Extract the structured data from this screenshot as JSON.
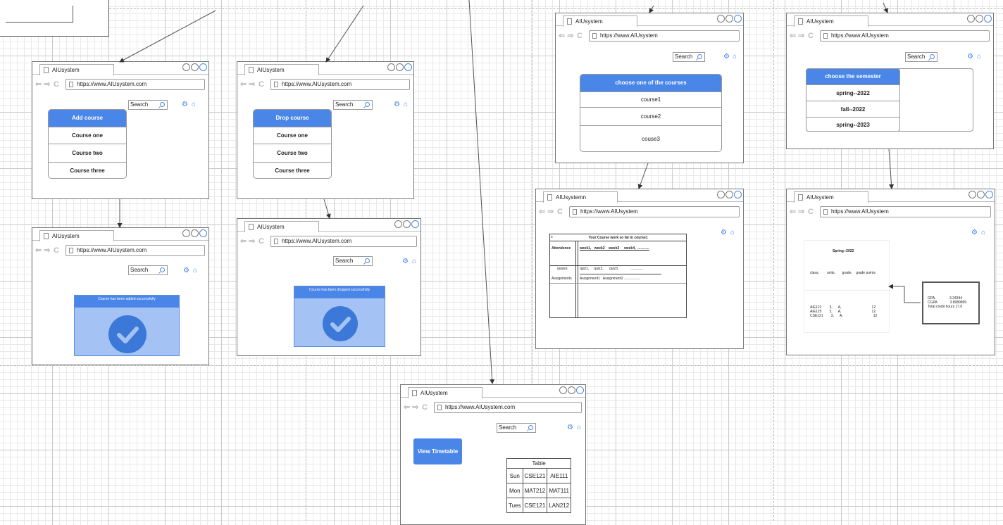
{
  "colors": {
    "accent": "#4a86e8",
    "confirm_panel": "#a4c2f4",
    "check": "#3c78d8"
  },
  "icons": {
    "back": "arrow-left-icon",
    "forward": "arrow-right-icon",
    "reload": "reload-icon",
    "settings": "gear-icon",
    "home": "home-icon",
    "search": "search-icon",
    "check": "checkmark-icon"
  },
  "glyphs": {
    "back": "⇐",
    "forward": "⇒",
    "reload": "C",
    "gear": "⚙",
    "home": "⌂"
  },
  "common": {
    "search_label": "Search"
  },
  "windows": {
    "add": {
      "tab": "AIUsystem",
      "url": "https://www.AIUsystem.com",
      "menu": {
        "header": "Add course",
        "items": [
          "Course one",
          "Course two",
          "Course three"
        ]
      }
    },
    "drop": {
      "tab": "AIUsystem",
      "url": "https://www.AIUsystem.com",
      "menu": {
        "header": "Drop course",
        "items": [
          "Course one",
          "Course two",
          "Course three"
        ]
      }
    },
    "added": {
      "tab": "AIUsystem",
      "url": "https://www.AIUsystem.com",
      "message": "Course has been added successfully"
    },
    "dropped": {
      "tab": "AIUsystem",
      "url": "https://www.AIUsystem.com",
      "message": "Course has been dropped successfully"
    },
    "choose_course": {
      "tab": "AIUsystem",
      "url": "https://www.AIUsystem",
      "menu": {
        "header": "choose one of the courses",
        "items": [
          "course1",
          "course2",
          "couse3"
        ]
      }
    },
    "choose_semester": {
      "tab": "AIUsystem",
      "url": "https://www.AIUsystem",
      "menu": {
        "header": "choose the semester",
        "items": [
          "spring--2022",
          "fall--2022",
          "spring--2023"
        ]
      }
    },
    "coursework": {
      "tab": "AIUsystemn",
      "url": "https://www.AIUsystem",
      "title": "Your Course work so far in course1",
      "corner": "≡",
      "row_labels": [
        "Attendence",
        "quizes",
        "Assignments"
      ],
      "weeks": "week1,   week2    week3     week4,  ............",
      "quizzes": "quiz1,     quiz2,      quiz3,            .............",
      "assignments": "Assignment1   Assignment2 ................"
    },
    "grades": {
      "tab": "AIUsystem",
      "url": "https://www.AIUsystem",
      "semester": "Spring--2022",
      "headers": "class,        units,       grade,    grade points",
      "rows": [
        "AIE121        3,      A,                               12",
        "AIE125        3,      A,                               12",
        "CSE121        3,      A,                               12"
      ],
      "gpa_lines": [
        "GPA,              3.24344",
        "CGPA             3.8989899",
        "Total credit hours 17.0"
      ]
    },
    "timetable": {
      "tab": "AIUsystem",
      "url": "https://www.AIUsystem.com",
      "button": "View Timetable",
      "table": {
        "caption": "Table",
        "rows": [
          [
            "Sun",
            "CSE121",
            "AIE111"
          ],
          [
            "Mon",
            "MAT212",
            "MAT111"
          ],
          [
            "Tues",
            "CSE121",
            "LAN212"
          ]
        ]
      }
    }
  }
}
